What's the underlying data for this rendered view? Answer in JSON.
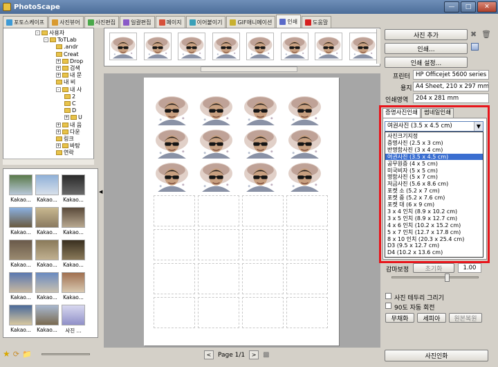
{
  "window": {
    "title": "PhotoScape"
  },
  "tabs": [
    {
      "label": "포토스케이프",
      "color": "#3d9ad6"
    },
    {
      "label": "사진뷰어",
      "color": "#d99a30"
    },
    {
      "label": "사진편집",
      "color": "#4aa84a"
    },
    {
      "label": "일괄편집",
      "color": "#8a5ac8"
    },
    {
      "label": "페이지",
      "color": "#d6503a"
    },
    {
      "label": "이어붙이기",
      "color": "#3aa0b8"
    },
    {
      "label": "GIF애니메이션",
      "color": "#c8b030"
    },
    {
      "label": "인쇄",
      "color": "#5a6ac8"
    },
    {
      "label": "도움말",
      "color": "#d62020"
    }
  ],
  "tree": {
    "items": [
      {
        "label": "사용자",
        "pm": "-"
      },
      {
        "label": "ToTLab",
        "pm": "-"
      },
      {
        "label": ".andr",
        "pm": ""
      },
      {
        "label": "Creat",
        "pm": ""
      },
      {
        "label": "Drop",
        "pm": "+"
      },
      {
        "label": "검색",
        "pm": "+"
      },
      {
        "label": "내 문",
        "pm": "+"
      },
      {
        "label": "내 비",
        "pm": ""
      },
      {
        "label": "내 사",
        "pm": "-"
      },
      {
        "label": "2",
        "pm": ""
      },
      {
        "label": "C",
        "pm": ""
      },
      {
        "label": "D",
        "pm": ""
      },
      {
        "label": "U",
        "pm": "+"
      },
      {
        "label": "내 음",
        "pm": "+"
      },
      {
        "label": "다운",
        "pm": "+"
      },
      {
        "label": "링크",
        "pm": ""
      },
      {
        "label": "바탕",
        "pm": "+"
      },
      {
        "label": "연락",
        "pm": ""
      }
    ]
  },
  "thumbs": {
    "captions": [
      "Kakao...",
      "Kakao...",
      "Kakao...",
      "Kakao...",
      "Kakao...",
      "Kakao...",
      "Kakao...",
      "Kakao...",
      "Kakao...",
      "Kakao...",
      "Kakao...",
      "Kakao...",
      "Kakao...",
      "Kakao...",
      "사진 ..."
    ]
  },
  "pager": {
    "label": "Page 1/1",
    "prev": "<",
    "next": ">"
  },
  "right": {
    "add_photo": "사진 추가",
    "print": "인쇄...",
    "print_settings": "인쇄 설정...",
    "printer_label": "프린터",
    "printer_value": "HP Officejet 5600 series",
    "paper_label": "용지",
    "paper_value": "A4 Sheet, 210 x 297 mm",
    "area_label": "인쇄영역",
    "area_value": "204 x 281 mm",
    "subtab_id": "증명사진인쇄",
    "subtab_thumb": "썸네일인쇄",
    "dropdown_value": "여권사진 (3.5 x 4.5 cm)",
    "options": [
      "사진크기지정",
      "증명사진 (2.5 x 3 cm)",
      "반명함사진 (3 x 4 cm)",
      "여권사진 (3.5 x 4.5 cm)",
      "공무원증 (4 x 5 cm)",
      "미국비자 (5 x 5 cm)",
      "명함사진 (5 x 7 cm)",
      "저금사진 (5.6 x 8.6 cm)",
      "포켓 소 (5.2 x 7 cm)",
      "포켓 중 (5.2 x 7.6 cm)",
      "포켓 대 (6 x 9 cm)",
      "3 x 4 인치 (8.9 x 10.2 cm)",
      "3 x 5 인치 (8.9 x 12.7 cm)",
      "4 x 6 인치 (10.2 x 15.2 cm)",
      "5 x 7 인치 (12.7 x 17.8 cm)",
      "8 x 10 인치 (20.3 x 25.4 cm)",
      "D3 (9.5 x 12.7 cm)",
      "D4 (10.2 x 13.6 cm)"
    ],
    "selected_index": 3,
    "gamma_label": "감마보정",
    "gamma_reset": "초기화",
    "gamma_value": "1.00",
    "border_label": "사진 테두리 그리기",
    "rotate_label": "90도 자동 회전",
    "mono": "무채화",
    "sepia": "세피아",
    "restore": "원본복원",
    "photo_print": "사진인화"
  },
  "colors": {
    "highlight": "#e8141a",
    "selection": "#3a6ed0"
  }
}
